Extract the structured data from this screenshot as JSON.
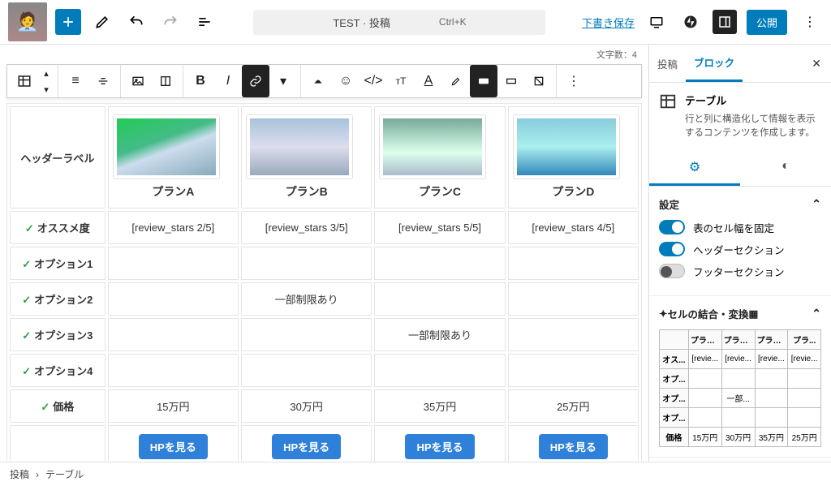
{
  "topbar": {
    "doc_title": "TEST · 投稿",
    "shortcut": "Ctrl+K",
    "save_draft": "下書き保存",
    "publish": "公開"
  },
  "wordcount": "文字数：4",
  "table": {
    "header_label": "ヘッダーラベル",
    "plans": [
      {
        "name": "プランA"
      },
      {
        "name": "プランB"
      },
      {
        "name": "プランC"
      },
      {
        "name": "プランD"
      }
    ],
    "rows": [
      {
        "label": "オススメ度",
        "cells": [
          "[review_stars 2/5]",
          "[review_stars 3/5]",
          "[review_stars 5/5]",
          "[review_stars 4/5]"
        ]
      },
      {
        "label": "オプション1",
        "cells": [
          "",
          "",
          "",
          ""
        ]
      },
      {
        "label": "オプション2",
        "cells": [
          "",
          "一部制限あり",
          "",
          ""
        ]
      },
      {
        "label": "オプション3",
        "cells": [
          "",
          "",
          "一部制限あり",
          ""
        ]
      },
      {
        "label": "オプション4",
        "cells": [
          "",
          "",
          "",
          ""
        ]
      },
      {
        "label": "価格",
        "cells": [
          "15万円",
          "30万円",
          "35万円",
          "25万円"
        ]
      }
    ],
    "cta_label": "HPを見る"
  },
  "sidebar": {
    "tab_post": "投稿",
    "tab_block": "ブロック",
    "block_name": "テーブル",
    "block_desc": "行と列に構造化して情報を表示するコンテンツを作成します。",
    "section_settings": "設定",
    "toggle_fixed": "表のセル幅を固定",
    "toggle_header": "ヘッダーセクション",
    "toggle_footer": "フッターセクション",
    "section_merge": "セルの結合・変換",
    "mini_headers": [
      "プランA",
      "プランB",
      "プランC",
      "プラ..."
    ],
    "mini_rows": [
      {
        "label": "オス...",
        "cells": [
          "[revie...",
          "[revie...",
          "[revie...",
          "[revie..."
        ]
      },
      {
        "label": "オプ...",
        "cells": [
          "",
          "",
          "",
          ""
        ]
      },
      {
        "label": "オプ...",
        "cells": [
          "",
          "一部...",
          "",
          ""
        ]
      },
      {
        "label": "オプ...",
        "cells": [
          "",
          "",
          "",
          ""
        ]
      },
      {
        "label": "価格",
        "cells": [
          "15万円",
          "30万円",
          "35万円",
          "25万円"
        ]
      }
    ]
  },
  "breadcrumb": {
    "root": "投稿",
    "sep": "›",
    "leaf": "テーブル"
  }
}
